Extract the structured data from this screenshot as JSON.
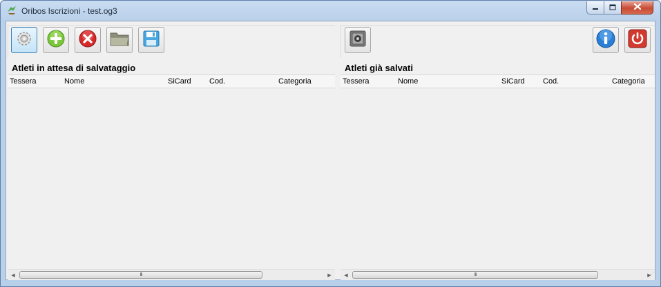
{
  "window": {
    "title": "Oribos Iscrizioni - test.og3"
  },
  "left_pane": {
    "title": "Atleti in attesa di salvataggio",
    "toolbar": [
      {
        "name": "settings-button",
        "icon": "gear-icon"
      },
      {
        "name": "add-button",
        "icon": "plus-icon"
      },
      {
        "name": "delete-button",
        "icon": "x-icon"
      },
      {
        "name": "open-folder-button",
        "icon": "folder-icon"
      },
      {
        "name": "save-button",
        "icon": "floppy-icon"
      }
    ],
    "columns": [
      "Tessera",
      "Nome",
      "SiCard",
      "Cod.",
      "Categoria"
    ],
    "rows": []
  },
  "right_pane": {
    "title": "Atleti già salvati",
    "toolbar": [
      {
        "name": "safe-button",
        "icon": "safe-icon"
      },
      {
        "name": "info-button",
        "icon": "info-icon"
      },
      {
        "name": "power-button",
        "icon": "power-icon"
      }
    ],
    "columns": [
      "Tessera",
      "Nome",
      "SiCard",
      "Cod.",
      "Categoria"
    ],
    "rows": []
  },
  "scrollbar_grip": "III",
  "colors": {
    "add": "#7cc63a",
    "delete": "#d62a2a",
    "info": "#2a7fd6",
    "power": "#d33a2f",
    "save": "#4aa7e0"
  }
}
